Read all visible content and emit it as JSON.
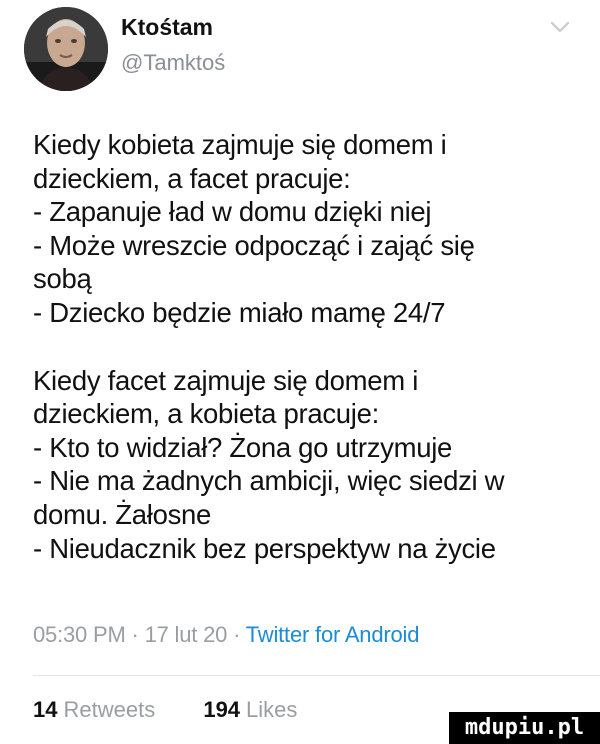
{
  "author": {
    "name": "Ktośtam",
    "handle": "@Tamktoś",
    "avatar_icon": "person-portrait-icon"
  },
  "tweet": {
    "lines_part1": [
      "Kiedy kobieta zajmuje się domem i",
      "dzieckiem, a facet pracuje:",
      "- Zapanuje ład w domu dzięki niej",
      "- Może wreszcie odpocząć i zająć się",
      "sobą",
      "- Dziecko będzie miało mamę 24/7"
    ],
    "lines_part2": [
      "Kiedy facet zajmuje się domem i",
      "dzieckiem, a kobieta pracuje:",
      "- Kto to widział? Żona go utrzymuje",
      "- Nie ma żadnych ambicji, więc siedzi w",
      "domu. Żałosne",
      "- Nieudacznik bez perspektyw na życie"
    ]
  },
  "meta": {
    "time": "05:30 PM",
    "sep1": "·",
    "date": "17 lut 20",
    "sep2": "·",
    "app": "Twitter for Android"
  },
  "stats": {
    "retweets_count": "14",
    "retweets_label": "Retweets",
    "likes_count": "194",
    "likes_label": "Likes"
  },
  "watermark": "mdupiu.pl",
  "colors": {
    "link": "#1a8cd8",
    "muted": "#9a9ea3"
  }
}
